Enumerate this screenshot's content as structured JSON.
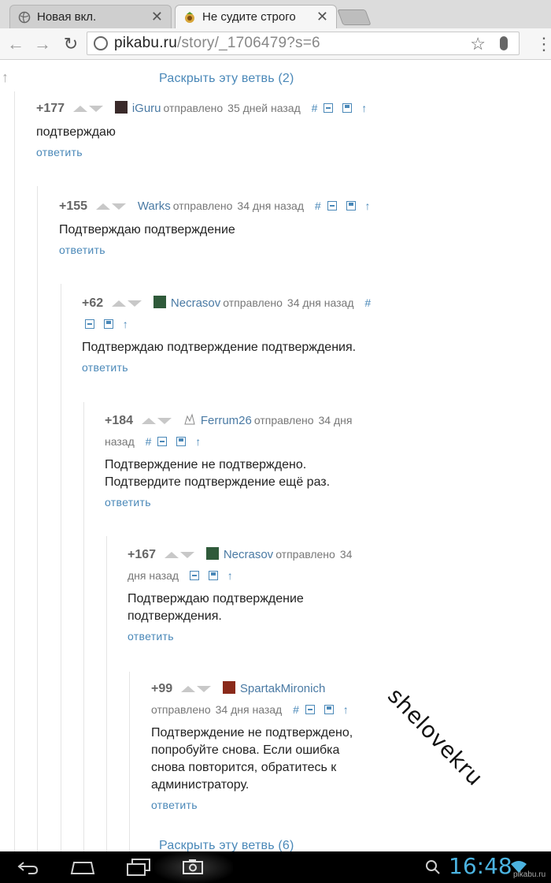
{
  "browser": {
    "tabs": [
      {
        "title": "Новая вкл.",
        "active": false
      },
      {
        "title": "Не судите строго",
        "active": true
      }
    ],
    "url_host": "pikabu.ru",
    "url_path": "/story/_1706479?s=6"
  },
  "page": {
    "expand_top": "Раскрыть эту ветвь (2)",
    "expand_bottom": "Раскрыть эту ветвь (6)",
    "sent_word": "отправлено",
    "reply_label": "ответить",
    "comments": [
      {
        "score": "+177",
        "author": "iGuru",
        "when": "35 дней назад",
        "text": "подтверждаю",
        "avatar": "avatar-dark"
      },
      {
        "score": "+155",
        "author": "Warks",
        "when": "34 дня назад",
        "text": "Подтверждаю подтверждение",
        "avatar": "none"
      },
      {
        "score": "+62",
        "author": "Necrasov",
        "when": "34 дня назад",
        "text": "Подтверждаю подтверждение подтверждения.",
        "avatar": "avatar-green"
      },
      {
        "score": "+184",
        "author": "Ferrum26",
        "when_a": "34 дня",
        "when_b": "назад",
        "text_lines": [
          "Подтверждение не подтверждено.",
          "Подтвердите подтверждение ещё раз."
        ],
        "avatar": "avatar-sketch"
      },
      {
        "score": "+167",
        "author": "Necrasov",
        "when_a": "34",
        "when_b": "дня назад",
        "text_lines": [
          "Подтверждаю подтверждение",
          "подтверждения."
        ],
        "avatar": "avatar-green"
      },
      {
        "score": "+99",
        "author": "SpartakMironich",
        "when": "34 дня назад",
        "text_lines": [
          "Подтверждение не подтверждено,",
          "попробуйте снова. Если ошибка",
          "снова повторится, обратитесь к",
          "администратору."
        ],
        "avatar": "avatar-red"
      }
    ],
    "watermark": "shelovekru"
  },
  "system": {
    "clock": "16:48",
    "site_mark": "pikabu.ru"
  },
  "colors": {
    "link": "#4a88b8",
    "author": "#4a7aa4",
    "clock": "#4bb3e0"
  }
}
